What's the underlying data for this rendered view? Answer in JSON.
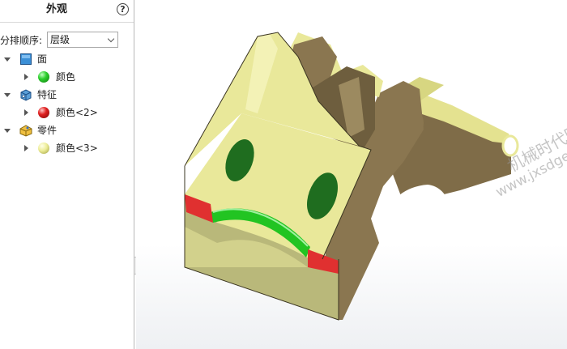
{
  "panel": {
    "title": "外观",
    "help_label": "?",
    "sort": {
      "label": "分排顺序:",
      "value": "层级"
    },
    "tree": [
      {
        "label": "面",
        "icon": "face-icon",
        "expanded": true,
        "children": [
          {
            "label": "颜色",
            "swatch": "#22c422"
          }
        ]
      },
      {
        "label": "特征",
        "icon": "feature-icon",
        "expanded": true,
        "children": [
          {
            "label": "颜色<2>",
            "swatch": "#d81818"
          }
        ]
      },
      {
        "label": "零件",
        "icon": "part-icon",
        "expanded": true,
        "children": [
          {
            "label": "颜色<3>",
            "swatch": "#ecec96"
          }
        ]
      }
    ]
  },
  "viewport": {
    "watermark_cn": "机械时代网",
    "watermark_url": "www.jxsdge.com",
    "colors": {
      "part_yellow": "#eded9c",
      "side_brown": "#8a7650",
      "face_green": "#22c422",
      "feature_red": "#e03030",
      "hole_green": "#1f6d1f"
    }
  }
}
